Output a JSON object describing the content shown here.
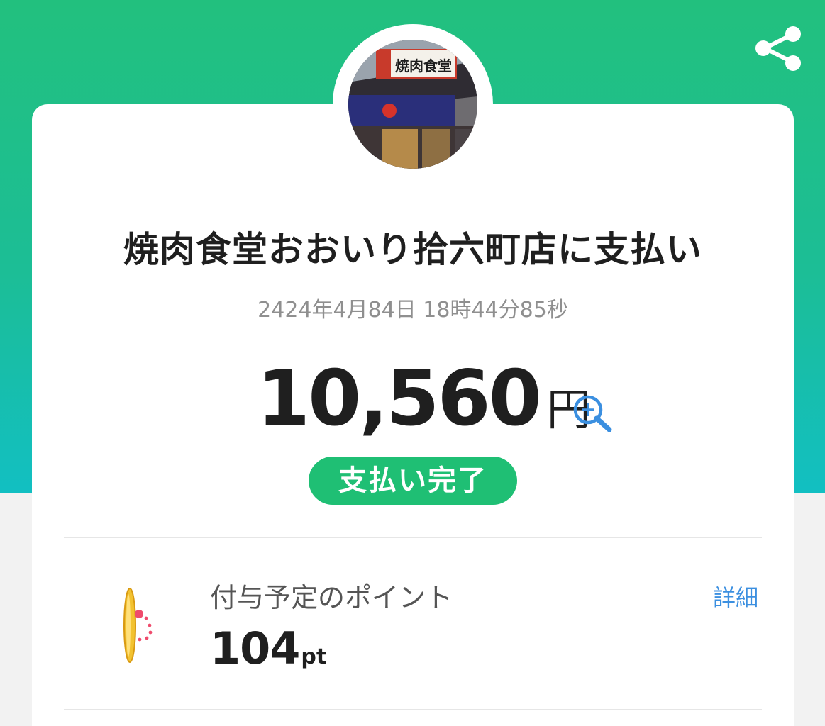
{
  "header": {
    "share_icon": "share-icon",
    "background_colors": [
      "#22c07e",
      "#12bfc2"
    ]
  },
  "merchant": {
    "logo_sign_text": "焼肉食堂",
    "title": "焼肉食堂おおいり拾六町店に支払い"
  },
  "payment": {
    "timestamp": "2424年4月84日 18時44分85秒",
    "amount": "10,560",
    "currency_unit": "円",
    "zoom_icon": "zoom-in-icon",
    "status": "支払い完了",
    "status_color": "#1fbf74"
  },
  "points": {
    "icon": "coin-icon",
    "label": "付与予定のポイント",
    "value": "104",
    "unit": "pt",
    "details_label": "詳細",
    "link_color": "#3b8fe0"
  }
}
